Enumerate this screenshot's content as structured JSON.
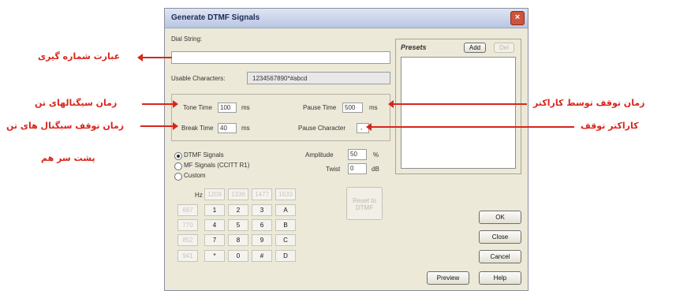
{
  "window": {
    "title": "Generate DTMF Signals"
  },
  "dial_string": {
    "label": "Dial String:",
    "value": ""
  },
  "usable": {
    "label": "Usable Characters:",
    "value": "1234567890*#abcd"
  },
  "timing": {
    "tone_time_label": "Tone Time",
    "tone_time_value": "100",
    "tone_unit": "ms",
    "break_time_label": "Break Time",
    "break_time_value": "40",
    "break_unit": "ms",
    "pause_time_label": "Pause Time",
    "pause_time_value": "500",
    "pause_unit": "ms",
    "pause_char_label": "Pause Character",
    "pause_char_value": ","
  },
  "signal_type": {
    "options": [
      "DTMF Signals",
      "MF Signals (CCITT R1)",
      "Custom"
    ],
    "selected": "DTMF Signals"
  },
  "amplitude": {
    "label": "Amplitude",
    "value": "50",
    "unit": "%"
  },
  "twist": {
    "label": "Twist",
    "value": "0",
    "unit": "dB"
  },
  "keypad": {
    "hz_label": "Hz",
    "col_freqs": [
      "1209",
      "1336",
      "1477",
      "1633"
    ],
    "row_freqs": [
      "697",
      "770",
      "852",
      "941"
    ],
    "rows": [
      [
        "1",
        "2",
        "3",
        "A"
      ],
      [
        "4",
        "5",
        "6",
        "B"
      ],
      [
        "7",
        "8",
        "9",
        "C"
      ],
      [
        "*",
        "0",
        "#",
        "D"
      ]
    ],
    "reset_label": "Reset to DTMF"
  },
  "presets": {
    "label": "Presets",
    "add_label": "Add",
    "del_label": "Del"
  },
  "buttons": {
    "ok": "OK",
    "close": "Close",
    "cancel": "Cancel",
    "preview": "Preview",
    "help": "Help"
  },
  "annotations": {
    "dial_string": "عبارت شماره گیری",
    "tone_time": "زمان سیگنالهای تن",
    "break_time_line1": "زمان توقف سیگنال های تن",
    "break_time_line2": "پشت سر هم",
    "pause_time": "زمان توقف توسط کاراکتر",
    "pause_char": "کاراکتر توقف"
  },
  "colors": {
    "annotation": "#d9251c",
    "dialog_bg": "#ece9d8"
  }
}
